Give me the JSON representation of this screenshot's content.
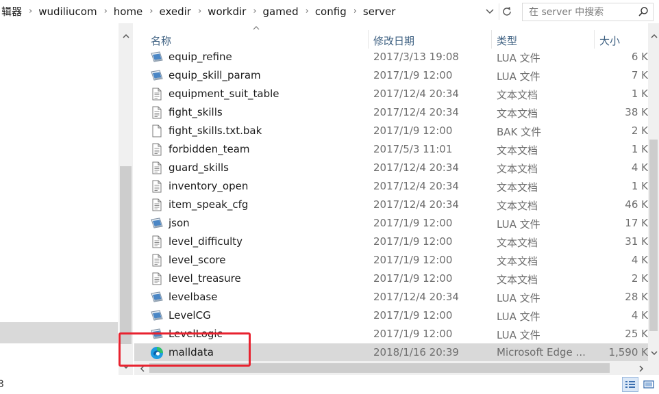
{
  "address_bar": {
    "breadcrumbs": [
      "辑器",
      "wudiliucom",
      "home",
      "exedir",
      "workdir",
      "gamed",
      "config",
      "server"
    ],
    "separator": "›"
  },
  "search": {
    "placeholder": "在 server 中搜索",
    "value": ""
  },
  "columns": {
    "name": "名称",
    "date": "修改日期",
    "type": "类型",
    "size": "大小"
  },
  "files": [
    {
      "name": "equip_refine",
      "date": "2017/3/13 19:08",
      "type": "LUA 文件",
      "size": "6 K",
      "icon": "lua-file-icon"
    },
    {
      "name": "equip_skill_param",
      "date": "2017/1/9 12:00",
      "type": "LUA 文件",
      "size": "7 K",
      "icon": "lua-file-icon"
    },
    {
      "name": "equipment_suit_table",
      "date": "2017/12/4 20:34",
      "type": "文本文档",
      "size": "1 K",
      "icon": "text-file-icon"
    },
    {
      "name": "fight_skills",
      "date": "2017/12/4 20:34",
      "type": "文本文档",
      "size": "38 K",
      "icon": "text-file-icon"
    },
    {
      "name": "fight_skills.txt.bak",
      "date": "2017/1/9 12:00",
      "type": "BAK 文件",
      "size": "2 K",
      "icon": "blank-file-icon"
    },
    {
      "name": "forbidden_team",
      "date": "2017/5/3 11:01",
      "type": "文本文档",
      "size": "1 K",
      "icon": "text-file-icon"
    },
    {
      "name": "guard_skills",
      "date": "2017/12/4 20:34",
      "type": "文本文档",
      "size": "4 K",
      "icon": "text-file-icon"
    },
    {
      "name": "inventory_open",
      "date": "2017/12/4 20:34",
      "type": "文本文档",
      "size": "1 K",
      "icon": "text-file-icon"
    },
    {
      "name": "item_speak_cfg",
      "date": "2017/12/4 20:34",
      "type": "文本文档",
      "size": "46 K",
      "icon": "text-file-icon"
    },
    {
      "name": "json",
      "date": "2017/1/9 12:00",
      "type": "LUA 文件",
      "size": "17 K",
      "icon": "lua-file-icon"
    },
    {
      "name": "level_difficulty",
      "date": "2017/1/9 12:00",
      "type": "文本文档",
      "size": "31 K",
      "icon": "text-file-icon"
    },
    {
      "name": "level_score",
      "date": "2017/1/9 12:00",
      "type": "文本文档",
      "size": "4 K",
      "icon": "text-file-icon"
    },
    {
      "name": "level_treasure",
      "date": "2017/1/9 12:00",
      "type": "文本文档",
      "size": "2 K",
      "icon": "text-file-icon"
    },
    {
      "name": "levelbase",
      "date": "2017/12/4 20:34",
      "type": "LUA 文件",
      "size": "28 K",
      "icon": "lua-file-icon"
    },
    {
      "name": "LevelCG",
      "date": "2017/1/9 12:00",
      "type": "LUA 文件",
      "size": "4 K",
      "icon": "lua-file-icon"
    },
    {
      "name": "LevelLogic",
      "date": "2017/1/9 12:00",
      "type": "LUA 文件",
      "size": "25 K",
      "icon": "lua-file-icon"
    },
    {
      "name": "malldata",
      "date": "2018/1/16 20:39",
      "type": "Microsoft Edge ...",
      "size": "1,590 K",
      "icon": "edge-icon",
      "selected": true
    }
  ],
  "status_bar": {
    "count_fragment": "3"
  },
  "colors": {
    "selection": "#d9d9d9",
    "highlight_box": "#e8222f",
    "header_text": "#3c5f80",
    "secondary_text": "#6d6d6d"
  }
}
